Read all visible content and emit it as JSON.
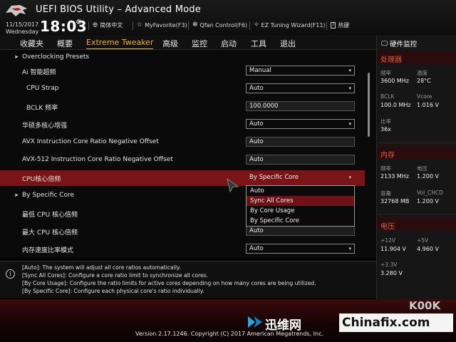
{
  "header": {
    "title": "UEFI BIOS Utility – Advanced Mode",
    "date": "11/15/2017",
    "weekday": "Wednesday",
    "time": "18:03",
    "toolbar": {
      "language": "简体中文",
      "myfavorite": "MyFavorite(F3)",
      "qfan": "Qfan Control(F6)",
      "ez_tuning": "EZ Tuning Wizard(F11)",
      "hotkeys": "热键"
    }
  },
  "tabs": [
    {
      "label": "收藏夹"
    },
    {
      "label": "概要"
    },
    {
      "label": "Extreme Tweaker",
      "active": true
    },
    {
      "label": "高级"
    },
    {
      "label": "监控"
    },
    {
      "label": "启动"
    },
    {
      "label": "工具"
    },
    {
      "label": "退出"
    }
  ],
  "settings": {
    "overclocking_presets": "Overclocking Presets",
    "rows": [
      {
        "label": "Ai 智能超频",
        "value": "Manual"
      },
      {
        "label": "CPU Strap",
        "value": "Auto"
      },
      {
        "label": "BCLK 频率",
        "value": "100.0000"
      },
      {
        "label": "华硕多核心增强",
        "value": "Auto"
      },
      {
        "label": "AVX Instruction Core Ratio Negative Offset",
        "value": "Auto"
      },
      {
        "label": "AVX-512 Instruction Core Ratio Negative Offset",
        "value": "Auto"
      },
      {
        "label": "CPU核心倍频",
        "value": "By Specific Core"
      },
      {
        "label": "By Specific Core"
      },
      {
        "label": "最低 CPU 核心倍频"
      },
      {
        "label": "最大 CPU 核心倍频",
        "value": "Auto"
      },
      {
        "label": "内存速度比率模式",
        "value": "Auto"
      }
    ]
  },
  "dropdown_menu": {
    "options": [
      "Auto",
      "Sync All Cores",
      "By Core Usage",
      "By Specific Core"
    ],
    "selected_index": 1
  },
  "help": {
    "lines": [
      "[Auto]: The system will adjust all core ratios automatically.",
      "[Sync All Cores]: Configure a core ratio limit to synchronize all cores.",
      "[By Core Usage]: Configure the ratio limits for active cores depending on how many cores are being utilized.",
      "[By Specific Core]: Configure each physical core's ratio individually."
    ]
  },
  "monitor": {
    "title": "硬件监控",
    "cpu": {
      "section": "处理器",
      "freq_label": "频率",
      "freq_value": "3600 MHz",
      "temp_label": "温度",
      "temp_value": "28°C",
      "bclk_label": "BCLK",
      "bclk_value": "100.0 MHz",
      "vcore_label": "Vcore",
      "vcore_value": "1.016 V",
      "ratio_label": "比率",
      "ratio_value": "36x"
    },
    "memory": {
      "section": "内存",
      "freq_label": "频率",
      "freq_value": "2133 MHz",
      "volt_label": "电压",
      "volt_value": "1.200 V",
      "cap_label": "容量",
      "cap_value": "32768 MB",
      "volchcd_label": "Vol_CHCD",
      "volchcd_value": "1.200 V"
    },
    "voltage": {
      "section": "电压",
      "v12_label": "+12V",
      "v12_value": "11.904 V",
      "v5_label": "+5V",
      "v5_value": "4.960 V",
      "v33_label": "+3.3V",
      "v33_value": "3.280 V"
    }
  },
  "footer": {
    "version": "Version 2.17.1246. Copyright (C) 2017 American Megatrends, Inc.",
    "watermark_1": "迅维网",
    "watermark_2": "Chinafix.com",
    "watermark_3": "K00K"
  },
  "colors": {
    "accent_tab": "#f2b233",
    "highlight_row": "#7a1418",
    "section_red": "#e25a3a"
  },
  "icons": [
    "rog-logo-icon",
    "gear-icon",
    "globe-icon",
    "star-icon",
    "fan-icon",
    "wand-icon",
    "help-key-icon",
    "monitor-icon",
    "info-icon",
    "mouse-cursor-icon",
    "chevron-down-icon",
    "chevron-right-icon"
  ]
}
